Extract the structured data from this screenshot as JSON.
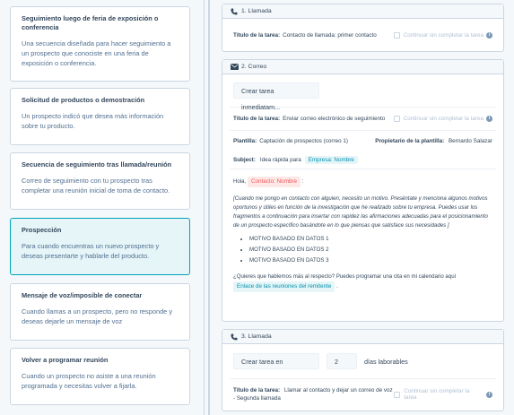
{
  "templates": [
    {
      "title": "Seguimiento luego de feria de exposición o conferencia",
      "desc": "Una secuencia diseñada para hacer seguimiento a un prospecto que conociste en una feria de exposición o conferencia."
    },
    {
      "title": "Solicitud de productos o demostración",
      "desc": "Un prospecto indicó que desea más información sobre tu producto."
    },
    {
      "title": "Secuencia de seguimiento tras llamada/reunión",
      "desc": "Correo de seguimiento con tu prospecto tras completar una reunión inicial de toma de contacto."
    },
    {
      "title": "Prospección",
      "desc": "Para cuando encuentras un nuevo prospecto y deseas presentarte y hablarle del producto."
    },
    {
      "title": "Mensaje de voz/imposible de conectar",
      "desc": "Cuando llamas a un prospecto, pero no responde y deseas dejarle un mensaje de voz"
    },
    {
      "title": "Volver a programar reunión",
      "desc": "Cuando un prospecto no asiste a una reunión programada y necesitas volver a fijarla."
    }
  ],
  "steps": {
    "s1": {
      "header": "1. Llamada",
      "task_label": "Título de la tarea:",
      "task_value": "Contacto de llamada: primer contacto",
      "continue_label": "Continuar sin completar la tarea"
    },
    "s2": {
      "header": "2. Correo",
      "create_task": "Crear tarea inmediatam...",
      "task_label": "Título de la tarea:",
      "task_value": "Enviar correo electrónico de seguimiento",
      "continue_label": "Continuar sin completar la tarea",
      "template_label": "Plantilla:",
      "template_value": "Captación de prospectos (correo 1)",
      "owner_label": "Propietario de la plantilla:",
      "owner_value": "Bernardo Salazar",
      "subject_label": "Subject:",
      "subject_value": "Idea rápida para",
      "subject_token": "Empresa: Nombre",
      "greeting": "Hola,",
      "greeting_token": "Contacto: Nombre",
      "greeting_end": ":",
      "body_italic": "[Cuando me pongo en contacto con alguien, necesito un motivo. Preséntate y menciona algunos motivos oportunos y útiles en función de la investigación que he realizado sobre tu empresa. Puedes usar los fragmentos a continuación para insertar con rapidez las afirmaciones adecuadas para el posicionamiento de un prospecto específico basándote en lo que piensas que satisface sus necesidades ]",
      "bullets": [
        "MOTIVO BASADO EN DATOS 1",
        "MOTIVO BASADO EN DATOS 2",
        "MOTIVO BASADO EN DATOS 3"
      ],
      "closing": "¿Quieres que hablemos más al respecto? Puedes programar una cita en mi calendario aquí",
      "closing_token": "Enlace de las reuniones del remitente",
      "closing_end": "."
    },
    "s3": {
      "header": "3. Llamada",
      "create_task": "Crear tarea en",
      "days_value": "2",
      "days_label": "días laborables",
      "task_label": "Título de la tarea:",
      "task_value": "Llamar al contacto y dejar un correo de voz - Segunda llamada",
      "continue_label": "Continuar sin completar la tarea"
    }
  },
  "icons": {
    "phone": "phone-icon",
    "email": "email-icon",
    "info": "info-icon"
  },
  "colors": {
    "accent": "#00a4bd",
    "token_bg": "#e5f5f8",
    "token_red": "#f2545b",
    "border": "#cbd6e2"
  }
}
